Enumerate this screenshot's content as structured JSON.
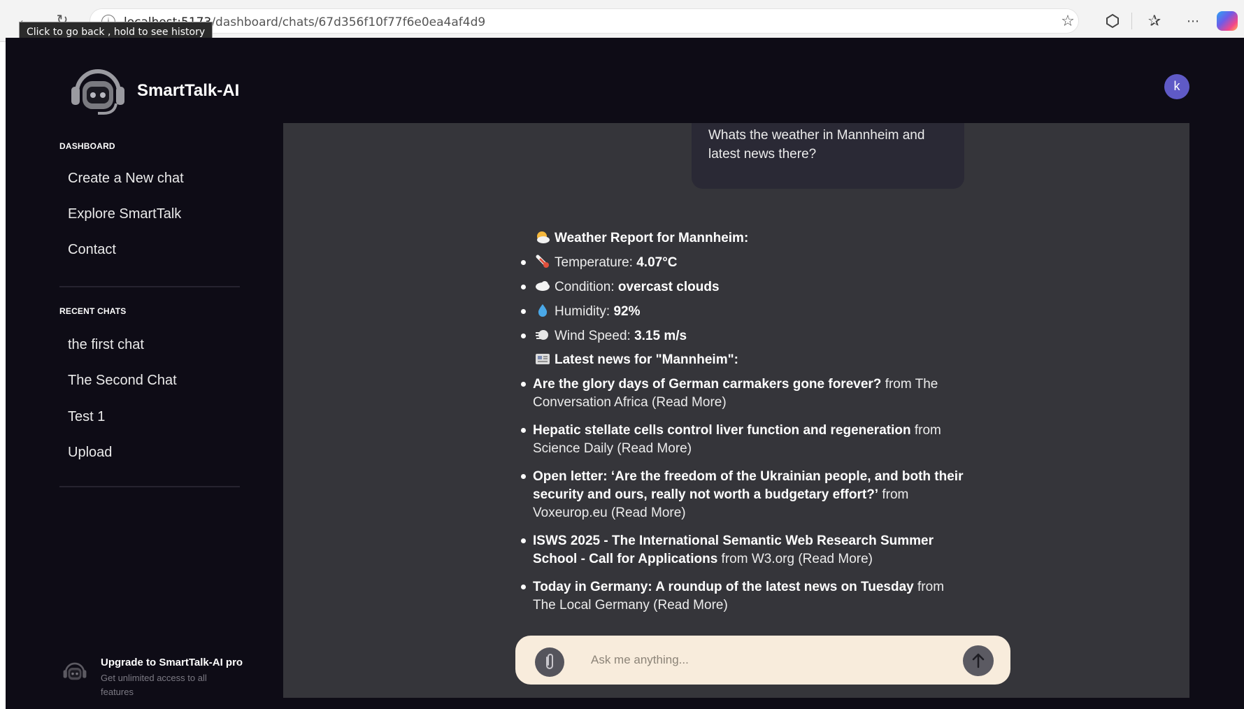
{
  "browser": {
    "url_host": "localhost:5173",
    "url_path": "/dashboard/chats/67d356f10f77f6e0ea4af4d9",
    "tooltip": "Click to go back , hold to see history"
  },
  "app": {
    "brand": "SmartTalk-AI",
    "avatar_letter": "k",
    "colors": {
      "background": "#0e0c16",
      "chat_panel": "#35353a",
      "avatar": "#5f5ac6",
      "input_bar": "#f8ecdc"
    }
  },
  "sidebar": {
    "dashboard_heading": "DASHBOARD",
    "dashboard_items": [
      {
        "label": "Create a New chat"
      },
      {
        "label": "Explore SmartTalk"
      },
      {
        "label": "Contact"
      }
    ],
    "recent_heading": "RECENT CHATS",
    "recent_items": [
      {
        "label": "the first chat"
      },
      {
        "label": "The Second Chat"
      },
      {
        "label": "Test 1"
      },
      {
        "label": "Upload"
      }
    ],
    "upgrade": {
      "title": "Upgrade to SmartTalk-AI pro",
      "subtitle": "Get unlimited access to all features"
    }
  },
  "chat": {
    "user_message": "Whats the weather in Mannheim and latest news there?",
    "weather": {
      "heading": "Weather Report for Mannheim:",
      "items": [
        {
          "icon": "thermometer-icon",
          "label": "Temperature: ",
          "value": "4.07°C"
        },
        {
          "icon": "cloud-icon",
          "label": "Condition: ",
          "value": "overcast clouds"
        },
        {
          "icon": "droplet-icon",
          "label": "Humidity: ",
          "value": "92%"
        },
        {
          "icon": "wind-icon",
          "label": "Wind Speed: ",
          "value": "3.15 m/s"
        }
      ]
    },
    "news": {
      "heading": "Latest news for \"Mannheim\":",
      "items": [
        {
          "title": "Are the glory days of German carmakers gone forever?",
          "source": "from The Conversation Africa",
          "link": "(Read More)"
        },
        {
          "title": "Hepatic stellate cells control liver function and regeneration",
          "source": "from Science Daily",
          "link": "(Read More)"
        },
        {
          "title": "Open letter: ‘Are the freedom of the Ukrainian people, and both their security and ours, really not worth a budgetary effort?’",
          "source": "from Voxeurop.eu",
          "link": "(Read More)"
        },
        {
          "title": "ISWS 2025 - The International Semantic Web Research Summer School - Call for Applications",
          "source": "from W3.org",
          "link": "(Read More)"
        },
        {
          "title": "Today in Germany: A roundup of the latest news on Tuesday",
          "source": "from The Local Germany",
          "link": "(Read More)"
        }
      ]
    }
  },
  "input": {
    "placeholder": "Ask me anything..."
  }
}
